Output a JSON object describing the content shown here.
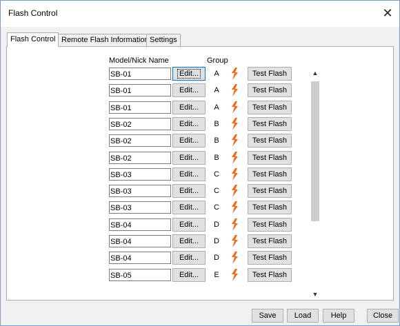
{
  "window": {
    "title": "Flash Control",
    "close_glyph": "✕"
  },
  "tabs": [
    {
      "label": "Flash Control",
      "active": true
    },
    {
      "label": "Remote Flash Information",
      "active": false
    },
    {
      "label": "Settings",
      "active": false
    }
  ],
  "table": {
    "headers": {
      "name": "Model/Nick Name",
      "group": "Group"
    },
    "edit_label": "Edit...",
    "test_label": "Test Flash",
    "bolt_color": "#f26c1b",
    "rows": [
      {
        "name": "SB-01",
        "group": "A"
      },
      {
        "name": "SB-01",
        "group": "A"
      },
      {
        "name": "SB-01",
        "group": "A"
      },
      {
        "name": "SB-02",
        "group": "B"
      },
      {
        "name": "SB-02",
        "group": "B"
      },
      {
        "name": "SB-02",
        "group": "B"
      },
      {
        "name": "SB-03",
        "group": "C"
      },
      {
        "name": "SB-03",
        "group": "C"
      },
      {
        "name": "SB-03",
        "group": "C"
      },
      {
        "name": "SB-04",
        "group": "D"
      },
      {
        "name": "SB-04",
        "group": "D"
      },
      {
        "name": "SB-04",
        "group": "D"
      },
      {
        "name": "SB-05",
        "group": "E"
      }
    ]
  },
  "scrollbar": {
    "up_glyph": "▲",
    "down_glyph": "▼"
  },
  "footer": {
    "save": "Save",
    "load": "Load",
    "help": "Help",
    "close": "Close"
  }
}
